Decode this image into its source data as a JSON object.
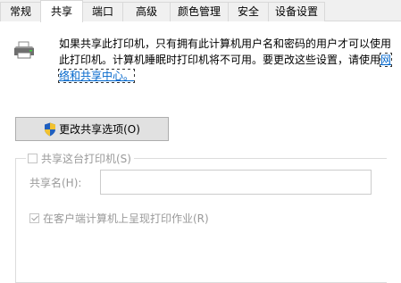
{
  "tabs": [
    {
      "label": "常规",
      "active": false
    },
    {
      "label": "共享",
      "active": true
    },
    {
      "label": "端口",
      "active": false
    },
    {
      "label": "高级",
      "active": false
    },
    {
      "label": "颜色管理",
      "active": false
    },
    {
      "label": "安全",
      "active": false
    },
    {
      "label": "设备设置",
      "active": false
    }
  ],
  "description": {
    "text": "如果共享此打印机，只有拥有此计算机用户名和密码的用户才可以使用此打印机。计算机睡眠时打印机将不可用。要更改这些设置，请使用",
    "link": "网络和共享中心。"
  },
  "change_sharing_button": "更改共享选项(O)",
  "share_group": {
    "title": "共享这台打印机(S)",
    "checked": false,
    "share_name_label": "共享名(H):",
    "share_name_value": "",
    "render_label": "在客户端计算机上呈现打印作业(R)",
    "render_checked": true
  },
  "icons": {
    "printer": "printer-icon",
    "shield": "uac-shield-icon"
  }
}
